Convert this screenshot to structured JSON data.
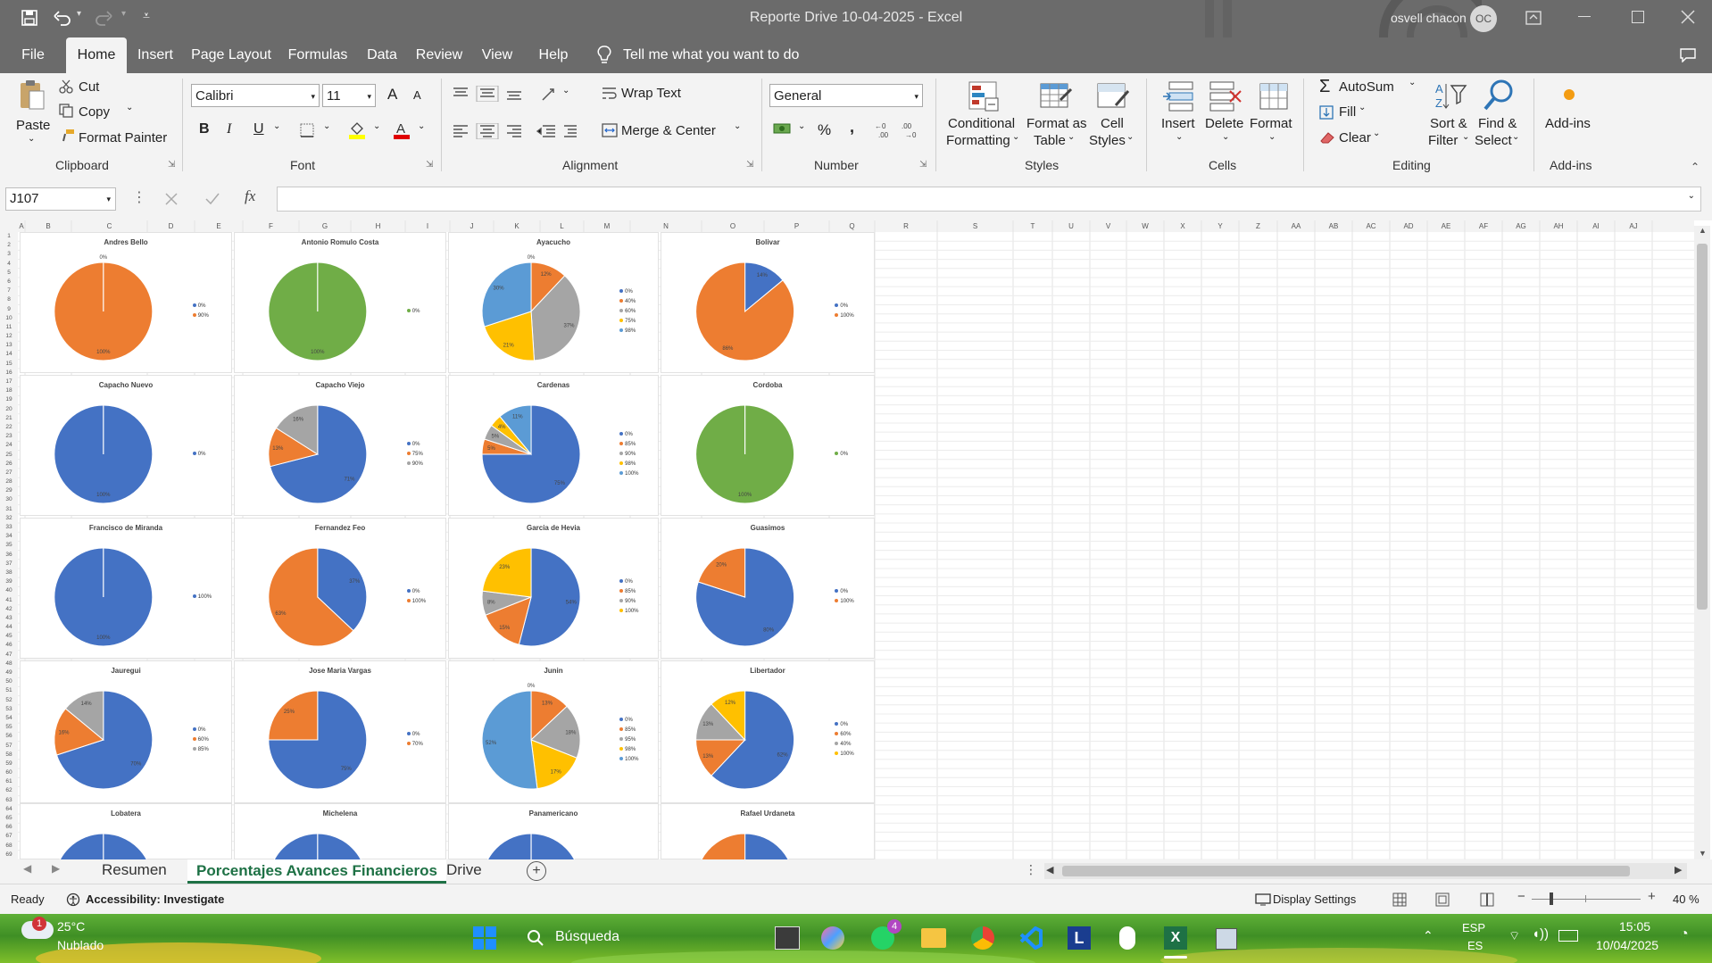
{
  "window": {
    "title": "Reporte Drive 10-04-2025  -  Excel",
    "user_name": "osvell chacon",
    "user_initials": "OC"
  },
  "menu": {
    "tabs": [
      "File",
      "Home",
      "Insert",
      "Page Layout",
      "Formulas",
      "Data",
      "Review",
      "View",
      "Help"
    ],
    "active": "Home",
    "tell_me": "Tell me what you want to do"
  },
  "ribbon": {
    "clipboard": {
      "paste": "Paste",
      "cut": "Cut",
      "copy": "Copy",
      "format_painter": "Format Painter",
      "label": "Clipboard"
    },
    "font": {
      "name": "Calibri",
      "size": "11",
      "label": "Font",
      "bold": "B",
      "italic": "I",
      "underline": "U",
      "grow": "A",
      "shrink": "A"
    },
    "alignment": {
      "wrap": "Wrap Text",
      "merge": "Merge & Center",
      "label": "Alignment"
    },
    "number": {
      "format": "General",
      "percent": "%",
      "comma": ",",
      "label": "Number"
    },
    "styles": {
      "conditional": "Conditional",
      "conditional2": "Formatting",
      "format_table": "Format as",
      "format_table2": "Table",
      "cell_styles": "Cell",
      "cell_styles2": "Styles",
      "label": "Styles"
    },
    "cells": {
      "insert": "Insert",
      "delete": "Delete",
      "format": "Format",
      "label": "Cells"
    },
    "editing": {
      "autosum": "AutoSum",
      "fill": "Fill",
      "clear": "Clear",
      "sort": "Sort &",
      "sort2": "Filter",
      "find": "Find &",
      "find2": "Select",
      "label": "Editing"
    },
    "addins": {
      "addins": "Add-ins",
      "label": "Add-ins"
    }
  },
  "formula_bar": {
    "name_box": "J107",
    "fx": "fx",
    "value": ""
  },
  "columns": [
    "A",
    "B",
    "C",
    "D",
    "E",
    "F",
    "G",
    "H",
    "I",
    "J",
    "K",
    "L",
    "M",
    "N",
    "O",
    "P",
    "Q",
    "R",
    "S",
    "T",
    "U",
    "V",
    "W",
    "X",
    "Y",
    "Z",
    "AA",
    "AB",
    "AC",
    "AD",
    "AE",
    "AF",
    "AG",
    "AH",
    "AI",
    "AJ"
  ],
  "chart_data": [
    {
      "type": "pie",
      "title": "Andres Bello",
      "categories": [
        "0%",
        "90%"
      ],
      "values": [
        0,
        100
      ],
      "labels": [
        "0%",
        "100%"
      ]
    },
    {
      "type": "pie",
      "title": "Antonio Romulo Costa",
      "categories": [
        "0%"
      ],
      "values": [
        100
      ],
      "labels": [
        "100%"
      ]
    },
    {
      "type": "pie",
      "title": "Ayacucho",
      "categories": [
        "0%",
        "40%",
        "60%",
        "75%",
        "98%"
      ],
      "values": [
        0,
        12,
        37,
        21,
        30
      ],
      "labels": [
        "0%",
        "12%",
        "37%",
        "21%",
        "30%"
      ]
    },
    {
      "type": "pie",
      "title": "Bolivar",
      "categories": [
        "0%",
        "100%"
      ],
      "values": [
        14,
        86
      ],
      "labels": [
        "14%",
        "86%"
      ]
    },
    {
      "type": "pie",
      "title": "Capacho Nuevo",
      "categories": [
        "0%"
      ],
      "values": [
        100
      ],
      "labels": [
        "100%"
      ]
    },
    {
      "type": "pie",
      "title": "Capacho Viejo",
      "categories": [
        "0%",
        "75%",
        "90%"
      ],
      "values": [
        71,
        13,
        16
      ],
      "labels": [
        "71%",
        "13%",
        "16%"
      ]
    },
    {
      "type": "pie",
      "title": "Cardenas",
      "categories": [
        "0%",
        "85%",
        "90%",
        "98%",
        "100%"
      ],
      "values": [
        75,
        5,
        5,
        4,
        11
      ],
      "labels": [
        "75%",
        "5%",
        "5%",
        "4%",
        "11%"
      ]
    },
    {
      "type": "pie",
      "title": "Cordoba",
      "categories": [
        "0%"
      ],
      "values": [
        100
      ],
      "labels": [
        "100%"
      ]
    },
    {
      "type": "pie",
      "title": "Francisco de Miranda",
      "categories": [
        "100%"
      ],
      "values": [
        100
      ],
      "labels": [
        "100%"
      ]
    },
    {
      "type": "pie",
      "title": "Fernandez Feo",
      "categories": [
        "0%",
        "100%"
      ],
      "values": [
        37,
        63
      ],
      "labels": [
        "37%",
        "63%"
      ]
    },
    {
      "type": "pie",
      "title": "Garcia de Hevia",
      "categories": [
        "0%",
        "85%",
        "90%",
        "100%"
      ],
      "values": [
        54,
        15,
        8,
        23
      ],
      "labels": [
        "54%",
        "15%",
        "8%",
        "23%"
      ]
    },
    {
      "type": "pie",
      "title": "Guasimos",
      "categories": [
        "0%",
        "100%"
      ],
      "values": [
        80,
        20
      ],
      "labels": [
        "80%",
        "20%"
      ]
    },
    {
      "type": "pie",
      "title": "Jauregui",
      "categories": [
        "0%",
        "60%",
        "85%"
      ],
      "values": [
        70,
        16,
        14
      ],
      "labels": [
        "70%",
        "16%",
        "14%"
      ]
    },
    {
      "type": "pie",
      "title": "Jose Maria Vargas",
      "categories": [
        "0%",
        "70%"
      ],
      "values": [
        75,
        25
      ],
      "labels": [
        "75%",
        "25%"
      ]
    },
    {
      "type": "pie",
      "title": "Junin",
      "categories": [
        "0%",
        "85%",
        "95%",
        "98%",
        "100%"
      ],
      "values": [
        0,
        13,
        18,
        17,
        52
      ],
      "labels": [
        "0%",
        "13%",
        "18%",
        "17%",
        "52%"
      ]
    },
    {
      "type": "pie",
      "title": "Libertador",
      "categories": [
        "0%",
        "60%",
        "40%",
        "100%"
      ],
      "values": [
        62,
        13,
        13,
        12
      ],
      "labels": [
        "62%",
        "13%",
        "13%",
        "12%"
      ]
    },
    {
      "type": "pie",
      "title": "Lobatera",
      "categories": [],
      "values": [
        100
      ],
      "labels": []
    },
    {
      "type": "pie",
      "title": "Michelena",
      "categories": [],
      "values": [
        100
      ],
      "labels": []
    },
    {
      "type": "pie",
      "title": "Panamericano",
      "categories": [],
      "values": [
        100
      ],
      "labels": []
    },
    {
      "type": "pie",
      "title": "Rafael Urdaneta",
      "categories": [],
      "values": [
        80,
        20
      ],
      "labels": [
        "20%"
      ]
    }
  ],
  "palette": [
    "#4472c4",
    "#ed7d31",
    "#a5a5a5",
    "#ffc000",
    "#5b9bd5",
    "#70ad47"
  ],
  "sheet_tabs": {
    "tabs": [
      "Resumen",
      "Porcentajes Avances Financieros",
      "Drive"
    ],
    "active": "Porcentajes Avances Financieros"
  },
  "status": {
    "ready": "Ready",
    "accessibility": "Accessibility: Investigate",
    "display_settings": "Display Settings",
    "zoom": "40 %"
  },
  "taskbar": {
    "weather_temp": "25°C",
    "weather_desc": "Nublado",
    "weather_badge": "1",
    "search": "Búsqueda",
    "lang1": "ESP",
    "lang2": "ES",
    "time": "15:05",
    "date": "10/04/2025",
    "whatsapp_badge": "4"
  }
}
